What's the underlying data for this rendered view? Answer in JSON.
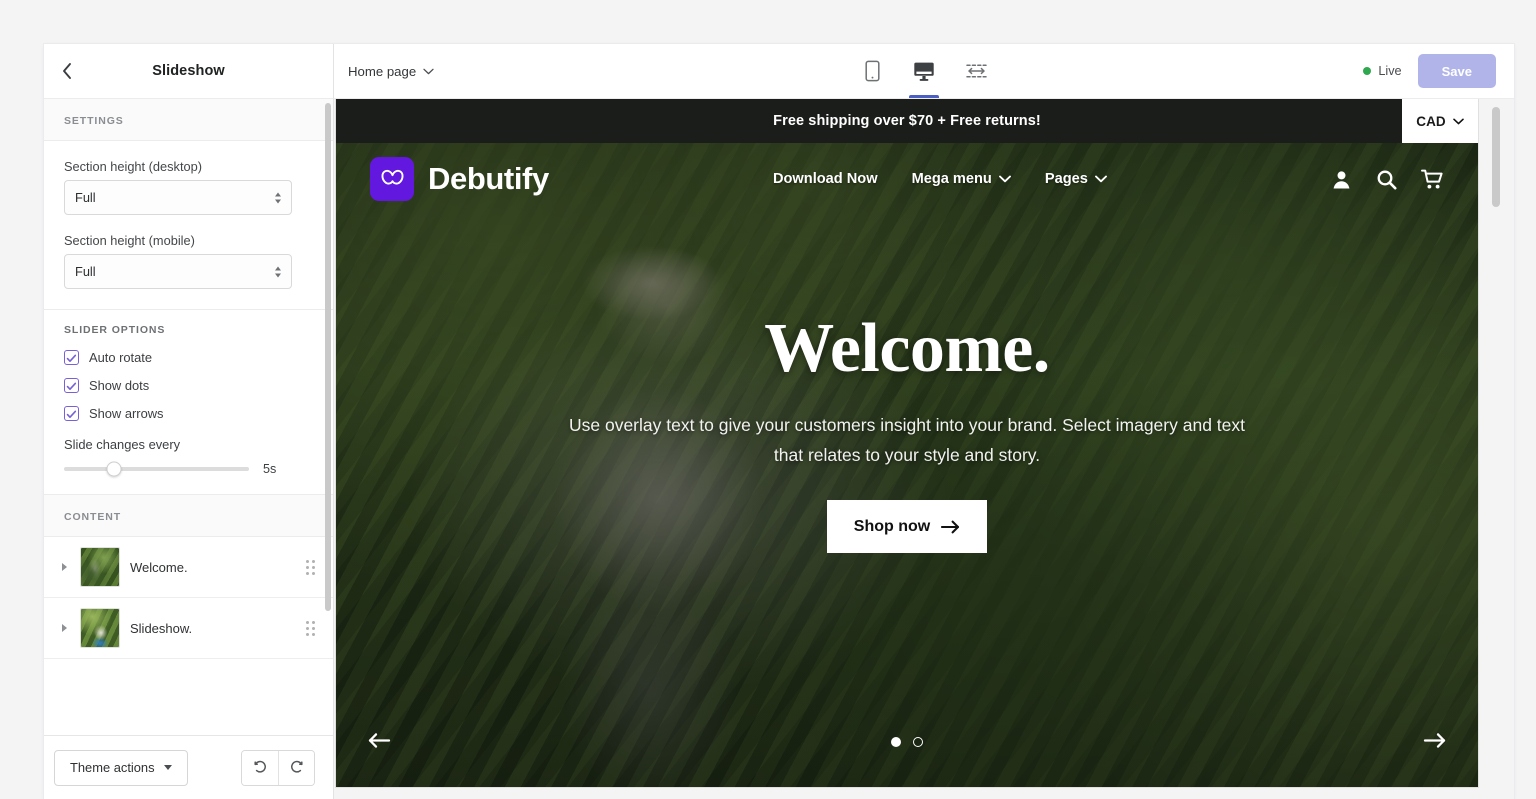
{
  "sidebar": {
    "back_icon": "chevron-left-icon",
    "title": "Slideshow",
    "settings_heading": "SETTINGS",
    "fields": [
      {
        "label": "Section height (desktop)",
        "value": "Full"
      },
      {
        "label": "Section height (mobile)",
        "value": "Full"
      }
    ],
    "slider_options_heading": "SLIDER OPTIONS",
    "checkboxes": [
      {
        "label": "Auto rotate",
        "checked": true
      },
      {
        "label": "Show dots",
        "checked": true
      },
      {
        "label": "Show arrows",
        "checked": true
      }
    ],
    "slide_interval_label": "Slide changes every",
    "slide_interval_value": "5s",
    "content_heading": "CONTENT",
    "content_items": [
      {
        "label": "Welcome."
      },
      {
        "label": "Slideshow."
      }
    ],
    "footer": {
      "theme_actions_label": "Theme actions",
      "undo_icon": "undo-icon",
      "redo_icon": "redo-icon"
    },
    "checkbox_accent": "#7a60d8"
  },
  "topbar": {
    "page_label": "Home page",
    "devices": [
      {
        "name": "mobile-view",
        "active": false
      },
      {
        "name": "desktop-view",
        "active": true
      },
      {
        "name": "full-width-view",
        "active": false
      }
    ],
    "live_label": "Live",
    "live_color": "#2fa84f",
    "save_label": "Save",
    "save_color": "#b0b4e8",
    "active_indicator_color": "#4b5ec4"
  },
  "preview": {
    "announcement": "Free shipping over $70 + Free returns!",
    "currency": "CAD",
    "brand_name": "Debutify",
    "brand_color": "#6318e0",
    "nav": [
      {
        "label": "Download Now",
        "has_caret": false
      },
      {
        "label": "Mega menu",
        "has_caret": true
      },
      {
        "label": "Pages",
        "has_caret": true
      }
    ],
    "header_icons": [
      "account-icon",
      "search-icon",
      "cart-icon"
    ],
    "hero_title": "Welcome.",
    "hero_subtitle": "Use overlay text to give your customers insight into your brand. Select imagery and text that relates to your style and story.",
    "cta_label": "Shop now",
    "slide_dots": [
      {
        "active": true
      },
      {
        "active": false
      }
    ],
    "prev_icon": "arrow-left-icon",
    "next_icon": "arrow-right-icon"
  }
}
